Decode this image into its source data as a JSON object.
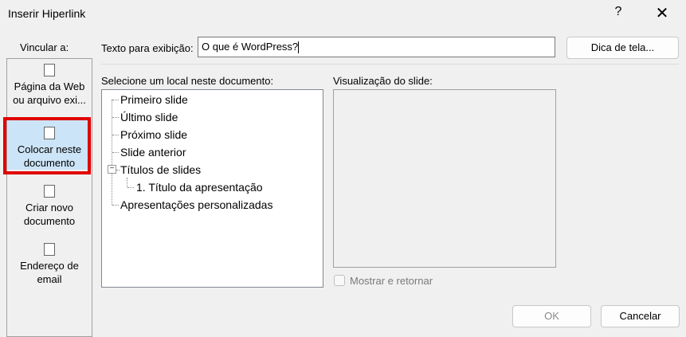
{
  "window": {
    "title": "Inserir Hiperlink",
    "help_label": "?",
    "close_label": "✕"
  },
  "sidebar": {
    "label": "Vincular a:",
    "items": [
      {
        "line1": "Página da Web",
        "line2": "ou arquivo exi...",
        "icon": "web-page-icon"
      },
      {
        "line1": "Colocar neste",
        "line2": "documento",
        "icon": "place-in-document-icon",
        "selected": true
      },
      {
        "line1": "Criar novo",
        "line2": "documento",
        "icon": "new-document-icon"
      },
      {
        "line1": "Endereço de",
        "line2": "email",
        "icon": "email-icon"
      }
    ]
  },
  "display_text": {
    "label": "Texto para exibição:",
    "value": "O que é WordPress?"
  },
  "screen_tip_button": "Dica de tela...",
  "select_place": {
    "label": "Selecione um local neste documento:",
    "items": [
      "Primeiro slide",
      "Último slide",
      "Próximo slide",
      "Slide anterior",
      "Títulos de slides",
      "1. Título da apresentação",
      "Apresentações personalizadas"
    ]
  },
  "preview": {
    "label": "Visualização do slide:"
  },
  "show_return": {
    "label": "Mostrar e retornar",
    "checked": false
  },
  "buttons": {
    "ok": "OK",
    "cancel": "Cancelar"
  },
  "colors": {
    "selected": "#cce4f7",
    "highlight": "#e00000"
  }
}
